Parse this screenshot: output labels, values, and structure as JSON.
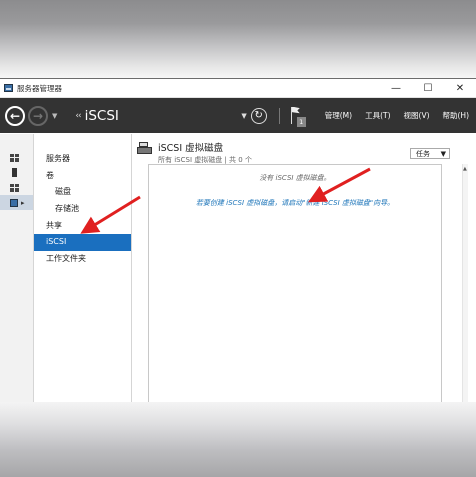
{
  "window": {
    "title": "服务器管理器",
    "controls": {
      "minimize": "—",
      "maximize": "☐",
      "close": "✕"
    }
  },
  "toolbar": {
    "back_icon": "back-arrow-icon",
    "forward_icon": "forward-arrow-icon",
    "breadcrumb_arrows": "‹‹",
    "breadcrumb": "iSCSI",
    "flag_badge": "1",
    "menu": [
      "管理(M)",
      "工具(T)",
      "视图(V)",
      "帮助(H)"
    ]
  },
  "iconbar": {
    "items": [
      "dashboard-icon",
      "local-server-icon",
      "all-servers-icon",
      "file-storage-icon"
    ]
  },
  "nav": {
    "items": [
      {
        "label": "服务器",
        "level": 0
      },
      {
        "label": "卷",
        "level": 0
      },
      {
        "label": "磁盘",
        "level": 1
      },
      {
        "label": "存储池",
        "level": 1
      },
      {
        "label": "共享",
        "level": 0
      },
      {
        "label": "iSCSI",
        "level": 0,
        "selected": true
      },
      {
        "label": "工作文件夹",
        "level": 0
      }
    ]
  },
  "main": {
    "title": "iSCSI 虚拟磁盘",
    "subtitle": "所有 iSCSI 虚拟磁盘 | 共 0 个",
    "tasks_label": "任务",
    "empty_message": "没有 iSCSI 虚拟磁盘。",
    "hint_message": "若要创建 iSCSI 虚拟磁盘，请启动\"新建 iSCSI 虚拟磁盘\"向导。"
  },
  "colors": {
    "toolbar_bg": "#333333",
    "selected_bg": "#1a6fbf",
    "link": "#1a73b8",
    "annotation_arrow": "#e02020"
  }
}
